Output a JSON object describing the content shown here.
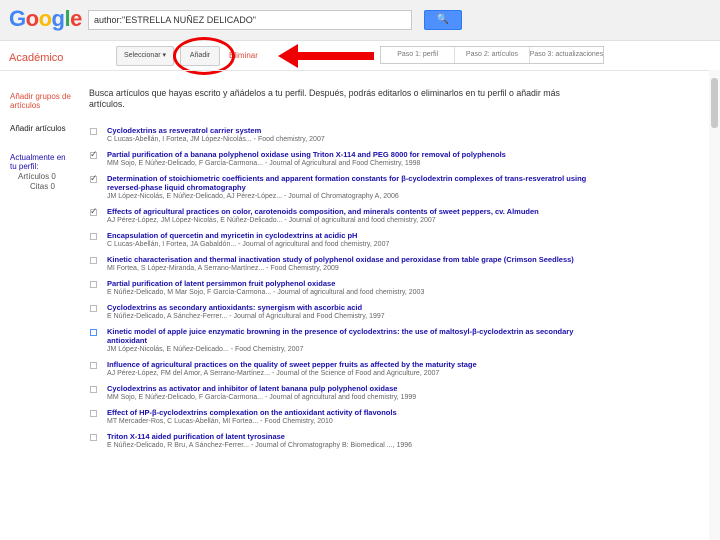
{
  "header": {
    "logo_parts": [
      {
        "t": "G",
        "c": "#4285f4"
      },
      {
        "t": "o",
        "c": "#ea4335"
      },
      {
        "t": "o",
        "c": "#fbbc05"
      },
      {
        "t": "g",
        "c": "#4285f4"
      },
      {
        "t": "l",
        "c": "#34a853"
      },
      {
        "t": "e",
        "c": "#ea4335"
      }
    ],
    "search_value": "author:\"ESTRELLA NUÑEZ DELICADO\"",
    "search_icon": "magnifier-icon",
    "search_glyph": "🔍"
  },
  "toolbar": {
    "section_label": "Académico",
    "select_label": "Seleccionar ▾",
    "add_label": "Añadir",
    "delete_label": "Eliminar",
    "steps": [
      "Paso 1: perfil",
      "Paso 2: artículos",
      "Paso 3: actualizaciones"
    ]
  },
  "sidebar": {
    "groups_link": "Añadir grupos de artículos",
    "articles_link": "Añadir artículos",
    "in_profile_label": "Actualmente en tu perfil:",
    "articles_count": "Artículos 0",
    "citations_count": "Citas 0"
  },
  "intro_text": "Busca artículos que hayas escrito y añádelos a tu perfil. Después, podrás editarlos o eliminarlos en tu perfil o añadir más artículos.",
  "articles": [
    {
      "title": "Cyclodextrins as resveratrol carrier system",
      "meta": "C Lucas-Abellán, I Fortea, JM López-Nicolás... - Food chemistry, 2007",
      "checked": false,
      "style": ""
    },
    {
      "title": "Partial purification of a banana polyphenol oxidase using Triton X-114 and PEG 8000 for removal of polyphenols",
      "meta": "MM Sojo, E Núñez-Delicado, F García-Carmona... - Journal of Agricultural and Food Chemistry, 1998",
      "checked": true,
      "style": ""
    },
    {
      "title": "Determination of stoichiometric coefficients and apparent formation constants for β-cyclodextrin complexes of trans-resveratrol using reversed-phase liquid chromatography",
      "meta": "JM López-Nicolás, E Núñez-Delicado, AJ Pérez-López... - Journal of Chromatography A, 2006",
      "checked": true,
      "style": ""
    },
    {
      "title": "Effects of agricultural practices on color, carotenoids composition, and minerals contents of sweet peppers, cv. Almuden",
      "meta": "AJ Pérez-López, JM López-Nicolás, E Núñez-Delicado... - Journal of agricultural and food chemistry, 2007",
      "checked": true,
      "style": ""
    },
    {
      "title": "Encapsulation of quercetin and myricetin in cyclodextrins at acidic pH",
      "meta": "C Lucas-Abellán, I Fortea, JA Gabaldón... - Journal of agricultural and food chemistry, 2007",
      "checked": false,
      "style": ""
    },
    {
      "title": "Kinetic characterisation and thermal inactivation study of polyphenol oxidase and peroxidase from table grape (Crimson Seedless)",
      "meta": "MI Fortea, S López-Miranda, A Serrano-Martínez... - Food Chemistry, 2009",
      "checked": false,
      "style": ""
    },
    {
      "title": "Partial purification of latent persimmon fruit polyphenol oxidase",
      "meta": "E Núñez-Delicado, M Mar Sojo, F García-Carmona... - Journal of agricultural and food chemistry, 2003",
      "checked": false,
      "style": ""
    },
    {
      "title": "Cyclodextrins as secondary antioxidants: synergism with ascorbic acid",
      "meta": "E Núñez-Delicado, A Sánchez-Ferrer... - Journal of Agricultural and Food Chemistry, 1997",
      "checked": false,
      "style": ""
    },
    {
      "title": "Kinetic model of apple juice enzymatic browning in the presence of cyclodextrins: the use of maltosyl-β-cyclodextrin as secondary antioxidant",
      "meta": "JM López-Nicolás, E Núñez-Delicado... - Food Chemistry, 2007",
      "checked": false,
      "style": "blue"
    },
    {
      "title": "Influence of agricultural practices on the quality of sweet pepper fruits as affected by the maturity stage",
      "meta": "AJ Pérez-López, FM del Amor, A Serrano-Martínez... - Journal of the Science of Food and Agriculture, 2007",
      "checked": false,
      "style": ""
    },
    {
      "title": "Cyclodextrins as activator and inhibitor of latent banana pulp polyphenol oxidase",
      "meta": "MM Sojo, E Núñez-Delicado, F García-Carmona... - Journal of agricultural and food chemistry, 1999",
      "checked": false,
      "style": ""
    },
    {
      "title": "Effect of HP-β-cyclodextrins complexation on the antioxidant activity of flavonols",
      "meta": "MT Mercader-Ros, C Lucas-Abellán, MI Fortea... - Food Chemistry, 2010",
      "checked": false,
      "style": ""
    },
    {
      "title": "Triton X-114 aided purification of latent tyrosinase",
      "meta": "E Núñez-Delicado, R Bru, A Sánchez-Ferrer... - Journal of Chromatography B: Biomedical ..., 1996",
      "checked": false,
      "style": ""
    }
  ],
  "colors": {
    "accent_red": "#dd4b39",
    "link_blue": "#1a0dab",
    "button_blue": "#4d90fe",
    "annotation_red": "#e00000"
  }
}
